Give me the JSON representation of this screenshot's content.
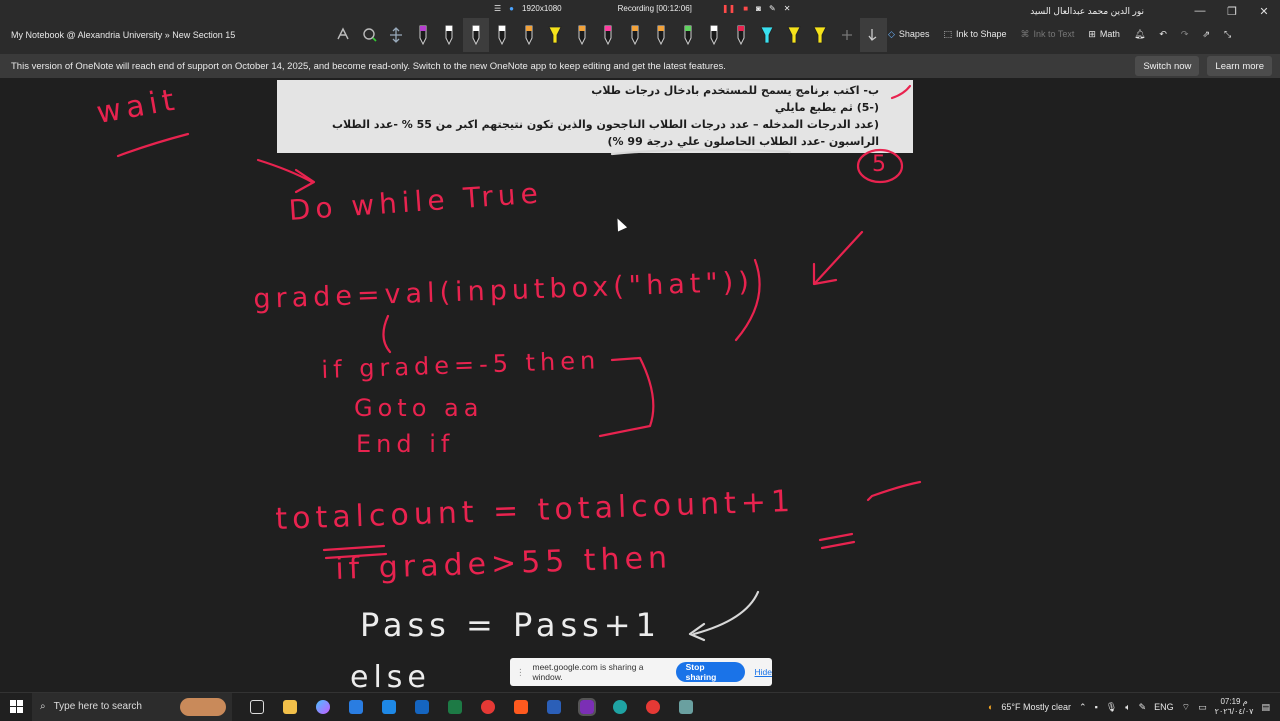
{
  "window": {
    "title": "My Notebook @ Alexandria University » New Section 15",
    "user": "نور الدين محمد عبدالعال السيد"
  },
  "recording": {
    "resolution": "1920x1080",
    "status": "Recording [00:12:06]"
  },
  "ribbon": {
    "shapes": "Shapes",
    "ink_to_shape": "Ink to Shape",
    "ink_to_text": "Ink to Text",
    "math": "Math"
  },
  "pen_colors": [
    "#b63fcf",
    "#ffffff",
    "#ffffff",
    "#ffffff",
    "#f2a23a",
    "#f5e21b",
    "#f2a23a",
    "#ff3ca0",
    "#f2a23a",
    "#f2a23a",
    "#5fd35f",
    "#ffffff",
    "#e8234f",
    "#39e0f0",
    "#f5e21b",
    "#f5e21b"
  ],
  "banner": {
    "message": "This version of OneNote will reach end of support on October 14, 2025, and become read-only. Switch to the new OneNote app to keep editing and get the latest features.",
    "switch_now": "Switch now",
    "learn_more": "Learn more"
  },
  "scan": {
    "line1": "ب- اكتب برنامج يسمح للمستخدم بادخال درجات طلاب",
    "line2": "(-5) ثم يطبع مايلي",
    "line3": "(عدد الدرجات المدخله – عدد درجات الطلاب الناجحون والذين تكون نتيجتهم اكبر من 55 % -عدد الطلاب",
    "line4": "الراسبون -عدد الطلاب الحاصلون علي درجة 99 %)"
  },
  "ink": {
    "wait": "wait",
    "line_do": "Do while True",
    "line_grade": "grade=val(inputbox(\"hat\"))",
    "line_if": "if grade=-5 then",
    "line_goto": "Goto aa",
    "line_endif": "End if",
    "line_total": "totalcount = totalcount+1",
    "line_ifgrade": "if grade>55 then",
    "line_pass": "Pass = Pass+1",
    "line_else": "else",
    "circled": "5"
  },
  "share_bar": {
    "message": "meet.google.com is sharing a window.",
    "stop": "Stop sharing",
    "hide": "Hide"
  },
  "taskbar": {
    "search_placeholder": "Type here to search",
    "weather": "65°F  Mostly clear",
    "language": "ENG",
    "time": "07:19 م",
    "date": "٢٠٢٦/٠٤/٠٧"
  }
}
